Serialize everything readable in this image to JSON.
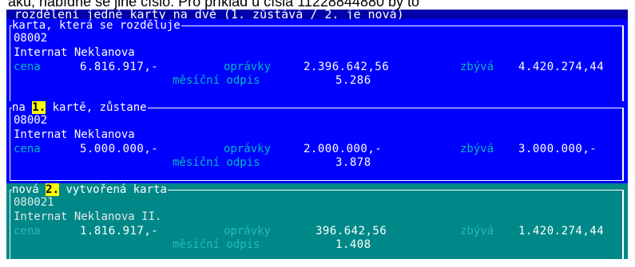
{
  "top_cut_text": "aku, nabídne se jiné číslo. Pro příklad u čísla 11228844880 by to",
  "screen_caption": "rozdělení jedné karty na dvě (1. zůstává / 2. je nová)",
  "labels": {
    "cena": "cena",
    "opravky": "oprávky",
    "zbyva": "zbývá",
    "mesicni_odpis": "měsíční odpis"
  },
  "colors": {
    "screen_bg": "#0000aa",
    "panel_blue": "#0000ff",
    "panel_teal": "#008888",
    "label_cyan": "#00bbbb",
    "highlight": "#ffff00"
  },
  "panels": [
    {
      "title": "karta, která se rozděluje",
      "code": "08002",
      "name": "Internat Neklanova",
      "cena": "6.816.917,-",
      "opravky": "2.396.642,56",
      "zbyva": "4.420.274,44",
      "mesicni_odpis": "5.286"
    },
    {
      "title_prefix": "na ",
      "title_number": "1.",
      "title_suffix": " kartě, zůstane",
      "code": "08002",
      "name": "Internat Neklanova",
      "cena": "5.000.000,-",
      "opravky": "2.000.000,-",
      "zbyva": "3.000.000,-",
      "mesicni_odpis": "3.878"
    },
    {
      "title_prefix": "nová ",
      "title_number": "2.",
      "title_suffix": " vytvořená karta",
      "code": "080021",
      "name": "Internat Neklanova II.",
      "cena": "1.816.917,-",
      "opravky": "396.642,56",
      "zbyva": "1.420.274,44",
      "mesicni_odpis": "1.408"
    }
  ]
}
